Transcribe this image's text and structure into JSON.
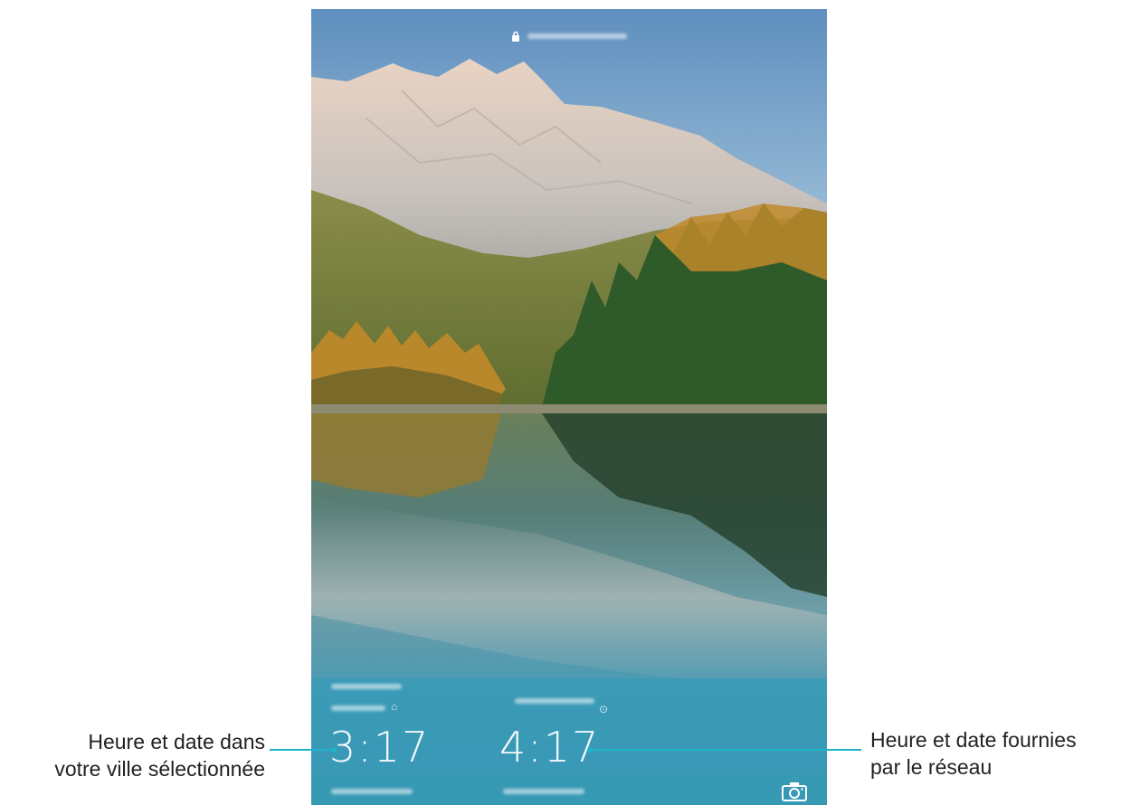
{
  "lockscreen": {
    "home_clock": {
      "time": "3:17"
    },
    "network_clock": {
      "time": "4:17"
    },
    "icons": {
      "status_lock": "lock-icon",
      "home": "home-icon",
      "location": "location-pin-icon",
      "camera": "camera-icon"
    }
  },
  "callouts": {
    "left": {
      "line1": "Heure et date dans",
      "line2": "votre ville sélectionnée"
    },
    "right": {
      "line1": "Heure et date fournies",
      "line2": "par le réseau"
    }
  },
  "colors": {
    "leader_line": "#1fb5c8",
    "callout_text": "#222222",
    "sky_top": "#6e9bc4",
    "water": "#3f98b4"
  }
}
